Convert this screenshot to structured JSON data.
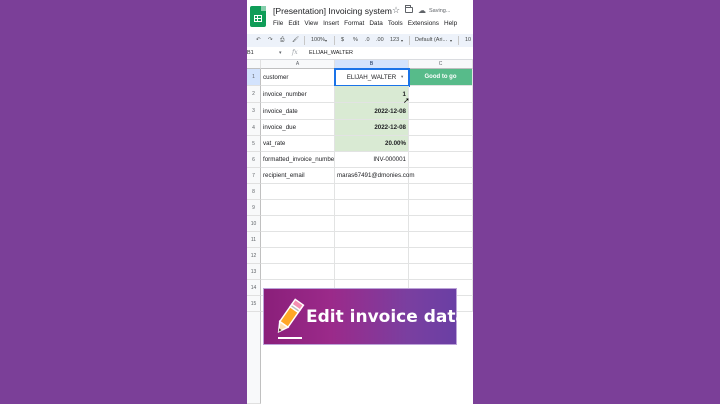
{
  "window": {
    "title": "[Presentation] Invoicing system",
    "save_status": "Saving..."
  },
  "menu": [
    "File",
    "Edit",
    "View",
    "Insert",
    "Format",
    "Data",
    "Tools",
    "Extensions",
    "Help"
  ],
  "toolbar": {
    "zoom": "100%",
    "currency": "$",
    "percent": "%",
    "decrease_decimal": ".0",
    "increase_decimal": ".00",
    "more_formats": "123",
    "font": "Default (Ari...",
    "font_size": "10"
  },
  "formula_bar": {
    "name_box": "B1",
    "value": "ELIJAH_WALTER"
  },
  "columns": [
    "A",
    "B",
    "C"
  ],
  "rows": [
    "1",
    "2",
    "3",
    "4",
    "5",
    "6",
    "7",
    "8",
    "9",
    "10",
    "11",
    "12",
    "13",
    "14",
    "15"
  ],
  "cells": [
    {
      "key": "customer",
      "value": "ELIJAH_WALTER",
      "status": "Good to go"
    },
    {
      "key": "invoice_number",
      "value": "1"
    },
    {
      "key": "invoice_date",
      "value": "2022-12-08"
    },
    {
      "key": "invoice_due",
      "value": "2022-12-08"
    },
    {
      "key": "vat_rate",
      "value": "20.00%"
    },
    {
      "key": "formatted_invoice_number",
      "value": "INV-000001"
    },
    {
      "key": "recipient_email",
      "value": "maras67491@dmonies.com"
    }
  ],
  "banner": {
    "label": "Edit invoice data",
    "icon": "pencil-icon"
  },
  "colors": {
    "background": "#7b3f98",
    "sheets_green": "#0f9d58",
    "input_cell_green": "#d9ead3",
    "status_green": "#57bb8a",
    "selection_blue": "#1a73e8"
  }
}
